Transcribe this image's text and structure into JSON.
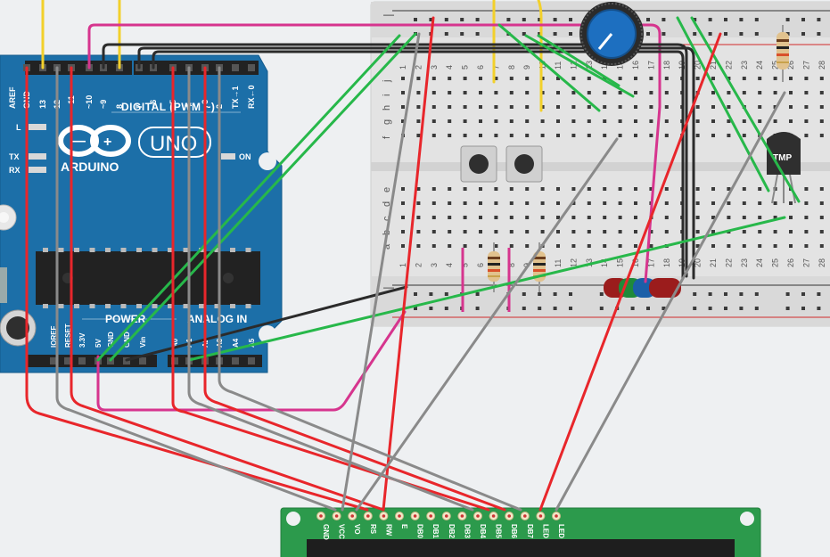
{
  "arduino": {
    "logo_text": "ARDUINO",
    "model": "UNO",
    "digital_label": "DIGITAL (PWM ~)",
    "power_label": "POWER",
    "analog_label": "ANALOG IN",
    "led_labels": [
      "L",
      "TX",
      "RX"
    ],
    "on_label": "ON",
    "header_top_pins": [
      "AREF",
      "GND",
      "13",
      "12",
      "~11",
      "~10",
      "~9",
      "8",
      "7",
      "~6",
      "~5",
      "4",
      "~3",
      "2",
      "TX→1",
      "RX←0"
    ],
    "header_bottom_pins": [
      "IOREF",
      "RESET",
      "3.3V",
      "5V",
      "GND",
      "GND",
      "Vin",
      "A0",
      "A1",
      "A2",
      "A3",
      "A4",
      "A5"
    ]
  },
  "breadboard": {
    "column_numbers": [
      "1",
      "2",
      "3",
      "4",
      "5",
      "6",
      "7",
      "8",
      "9",
      "10",
      "11",
      "12",
      "13",
      "14",
      "15",
      "16",
      "17",
      "18",
      "19",
      "20",
      "21",
      "22",
      "23",
      "24",
      "25",
      "26",
      "27",
      "28"
    ],
    "top_rows": [
      "j",
      "i",
      "h",
      "g",
      "f"
    ],
    "bottom_rows": [
      "e",
      "d",
      "c",
      "b",
      "a"
    ],
    "rail_minus": "—",
    "rail_plus": "+"
  },
  "components": {
    "temp_sensor_label": "TMP"
  },
  "lcd": {
    "pins": [
      "GND",
      "VCC",
      "VO",
      "RS",
      "RW",
      "E",
      "DB0",
      "DB1",
      "DB2",
      "DB3",
      "DB4",
      "DB5",
      "DB6",
      "DB7",
      "LED",
      "LED"
    ]
  },
  "colors": {
    "arduino_board": "#1c6fa8",
    "breadboard": "#e6e6e6",
    "lcd_board": "#2c9a4c",
    "wire_red": "#e8262b",
    "wire_black": "#2b2b2b",
    "wire_gray": "#8a8a8a",
    "wire_green": "#27b84a",
    "wire_pink": "#d6358e",
    "wire_yellow": "#f2d02b"
  }
}
